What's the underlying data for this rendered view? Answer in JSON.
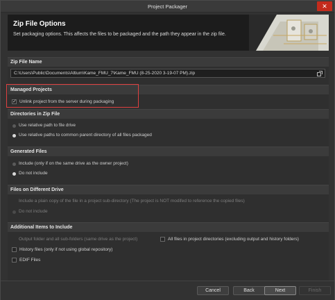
{
  "window": {
    "title": "Project Packager"
  },
  "header": {
    "title": "Zip File Options",
    "description": "Set packaging options. This affects the files to be packaged and the path they appear in the zip file."
  },
  "zip_file": {
    "section_label": "Zip File Name",
    "value": "C:\\Users\\Public\\Documents\\Altium\\Kame_FMU_7\\Kame_FMU (8-25-2020 3-19-07 PM).zip"
  },
  "managed_projects": {
    "section_label": "Managed Projects",
    "unlink_label": "Unlink project from the server during packaging",
    "unlink_checked": true
  },
  "directories": {
    "section_label": "Directories in Zip File",
    "options": [
      {
        "label": "Use relative path to file drive",
        "selected": false
      },
      {
        "label": "Use relative paths to common parent directory of all files packaged",
        "selected": true
      }
    ]
  },
  "generated_files": {
    "section_label": "Generated Files",
    "options": [
      {
        "label": "Include (only if on the same drive as the owner project)",
        "selected": false
      },
      {
        "label": "Do not include",
        "selected": true
      }
    ]
  },
  "different_drive": {
    "section_label": "Files on Different Drive",
    "options": [
      {
        "label": "Include a plain copy of the file in a project sub-directory (The project is NOT modifed to reference the copied files)",
        "selected": false
      },
      {
        "label": "Do not include",
        "selected": true
      }
    ]
  },
  "additional": {
    "section_label": "Additional Items to Include",
    "output_folder_label": "Output folder and all sub-folders (same drive as the project)",
    "all_files_label": "All files in project directories (excluding output and history folders)",
    "history_label": "History files (only if not using global repository)",
    "edif_label": "EDIF Files"
  },
  "buttons": {
    "cancel": "Cancel",
    "back": "Back",
    "next": "Next",
    "finish": "Finish"
  }
}
